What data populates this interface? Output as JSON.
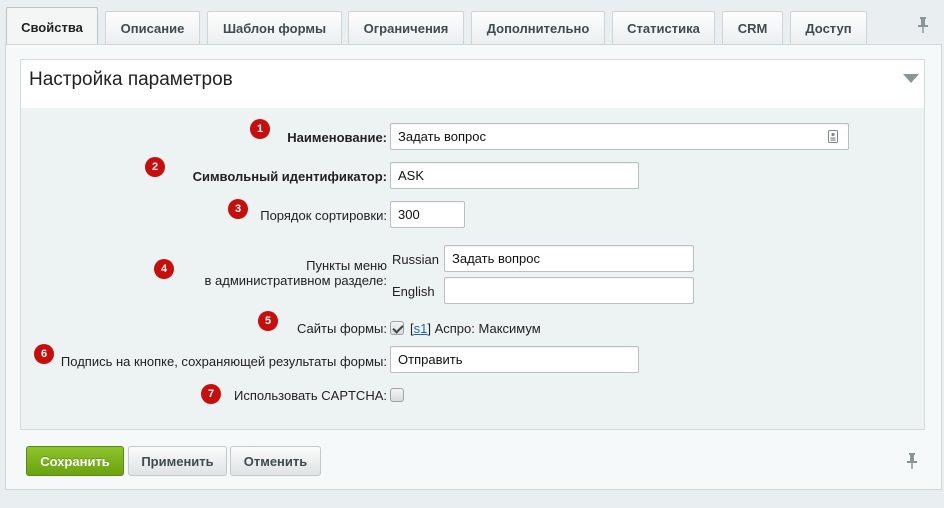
{
  "tabs": [
    {
      "label": "Свойства"
    },
    {
      "label": "Описание"
    },
    {
      "label": "Шаблон формы"
    },
    {
      "label": "Ограничения"
    },
    {
      "label": "Дополнительно"
    },
    {
      "label": "Статистика"
    },
    {
      "label": "CRM"
    },
    {
      "label": "Доступ"
    }
  ],
  "active_tab": "Свойства",
  "section": {
    "title": "Настройка параметров"
  },
  "form": {
    "name": {
      "badge": "1",
      "label": "Наименование:",
      "value": "Задать вопрос"
    },
    "code": {
      "badge": "2",
      "label": "Символьный идентификатор:",
      "value": "ASK"
    },
    "sort": {
      "badge": "3",
      "label": "Порядок сортировки:",
      "value": "300"
    },
    "menu": {
      "badge": "4",
      "label_line1": "Пункты меню",
      "label_line2": "в административном разделе:",
      "russian_label": "Russian",
      "russian_value": "Задать вопрос",
      "english_label": "English",
      "english_value": ""
    },
    "sites": {
      "badge": "5",
      "label": "Сайты формы:",
      "checked": true,
      "site_id": "s1",
      "site_name": "Аспро: Максимум"
    },
    "button_caption": {
      "badge": "6",
      "label": "Подпись на кнопке, сохраняющей результаты формы:",
      "value": "Отправить"
    },
    "captcha": {
      "badge": "7",
      "label": "Использовать CAPTCHA:",
      "checked": false
    }
  },
  "buttons": {
    "save": "Сохранить",
    "apply": "Применить",
    "cancel": "Отменить"
  },
  "icons": {
    "tabs_pin": "pin-icon",
    "collapse": "triangle-down-icon",
    "name_field": "id-card-icon",
    "footer_pin": "pin-icon"
  },
  "colors": {
    "badge": "#c80d0d",
    "primary_button": "#7ab51d",
    "link": "#2067b0"
  }
}
